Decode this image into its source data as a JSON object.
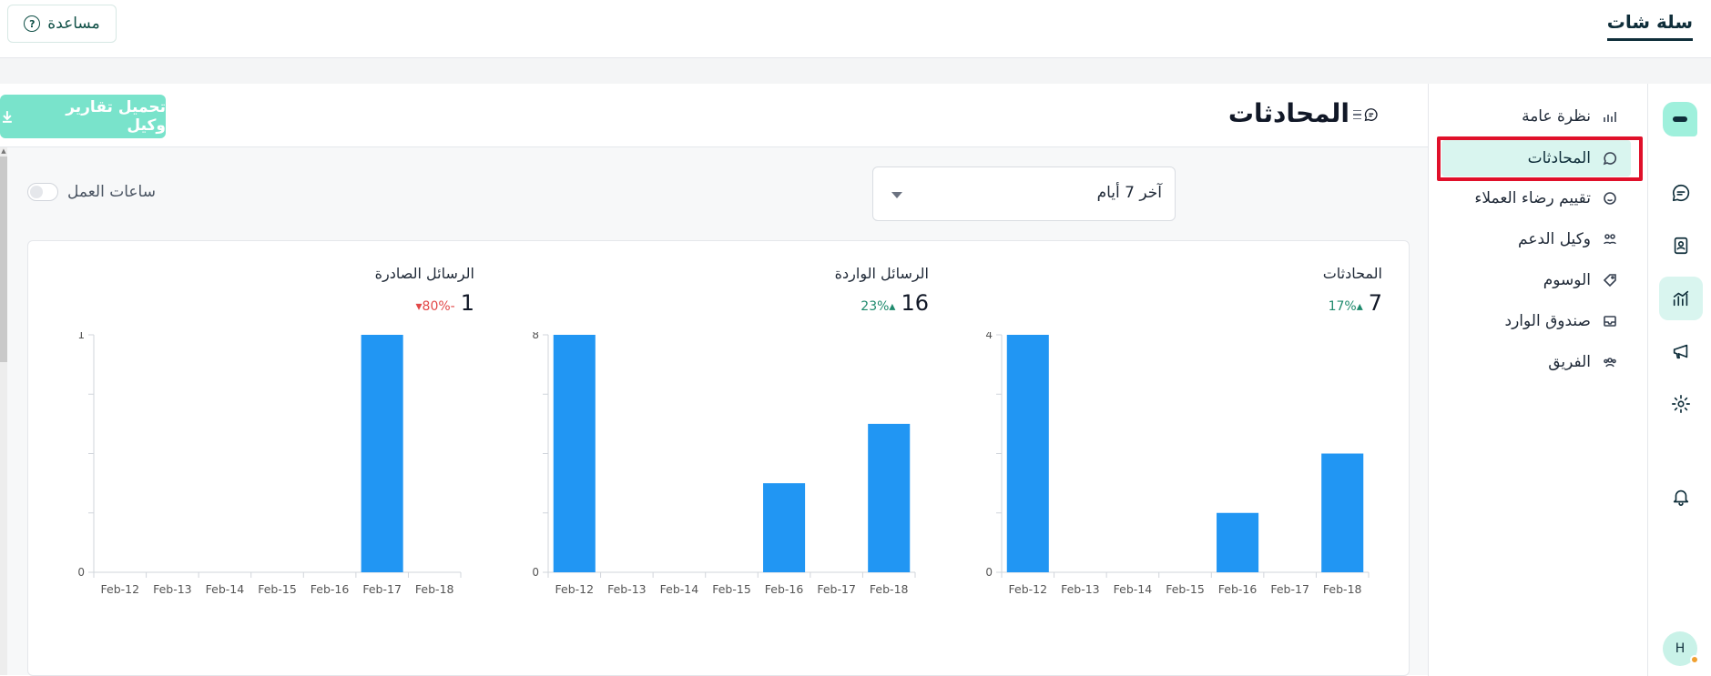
{
  "topbar": {
    "brand": "سلة شات",
    "help_label": "مساعدة"
  },
  "rail": {
    "items": [
      "logo",
      "chat-icon",
      "contacts-icon",
      "reports-icon",
      "campaigns-icon",
      "settings-icon",
      "bell-icon"
    ],
    "active": "reports-icon",
    "avatar_initial": "H"
  },
  "subnav": {
    "items": [
      {
        "label": "نظرة عامة",
        "icon": "chart-icon"
      },
      {
        "label": "المحادثات",
        "icon": "chat-icon"
      },
      {
        "label": "تقييم رضاء العملاء",
        "icon": "smile-icon"
      },
      {
        "label": "وكيل الدعم",
        "icon": "agents-icon"
      },
      {
        "label": "الوسوم",
        "icon": "tag-icon"
      },
      {
        "label": "صندوق الوارد",
        "icon": "inbox-icon"
      },
      {
        "label": "الفريق",
        "icon": "team-icon"
      }
    ],
    "active_index": 1
  },
  "header": {
    "title": "المحادثات",
    "download_label": "تحميل تقارير وكيل"
  },
  "filters": {
    "range_value": "آخر 7 أيام",
    "working_hours_label": "ساعات العمل",
    "working_hours_on": false
  },
  "colors": {
    "accent": "#79e3cb",
    "bar": "#2196f3",
    "up": "#1f8a6d",
    "down": "#e24848"
  },
  "chart_data": [
    {
      "type": "bar",
      "title": "المحادثات",
      "total": "7",
      "change": "17%",
      "change_dir": "up",
      "categories": [
        "Feb-12",
        "Feb-13",
        "Feb-14",
        "Feb-15",
        "Feb-16",
        "Feb-17",
        "Feb-18"
      ],
      "values": [
        4,
        0,
        0,
        0,
        1,
        0,
        2
      ],
      "ylim": [
        0,
        4
      ],
      "ytick_labels": [
        "0",
        "4"
      ]
    },
    {
      "type": "bar",
      "title": "الرسائل الواردة",
      "total": "16",
      "change": "23%",
      "change_dir": "up",
      "categories": [
        "Feb-12",
        "Feb-13",
        "Feb-14",
        "Feb-15",
        "Feb-16",
        "Feb-17",
        "Feb-18"
      ],
      "values": [
        8,
        0,
        0,
        0,
        3,
        0,
        5
      ],
      "ylim": [
        0,
        8
      ],
      "ytick_labels": [
        "0",
        "8"
      ]
    },
    {
      "type": "bar",
      "title": "الرسائل الصادرة",
      "total": "1",
      "change": "80%-",
      "change_dir": "down",
      "categories": [
        "Feb-12",
        "Feb-13",
        "Feb-14",
        "Feb-15",
        "Feb-16",
        "Feb-17",
        "Feb-18"
      ],
      "values": [
        0,
        0,
        0,
        0,
        0,
        1,
        0
      ],
      "ylim": [
        0,
        1
      ],
      "ytick_labels": [
        "0",
        "1"
      ]
    }
  ]
}
